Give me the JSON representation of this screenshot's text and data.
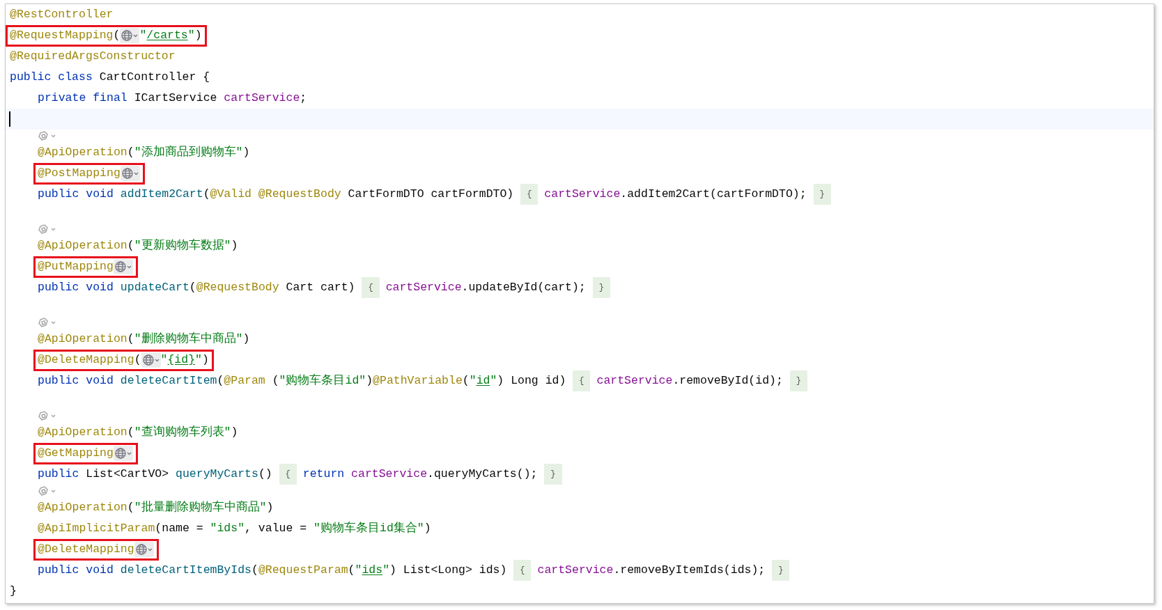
{
  "editor": {
    "lines": [
      {
        "kind": "code",
        "highlighted": false,
        "tokens": [
          {
            "kind": "annotation",
            "text": "@RestController"
          }
        ]
      },
      {
        "kind": "code",
        "highlighted": true,
        "tokens": [
          {
            "kind": "annotation",
            "text": "@RequestMapping"
          },
          {
            "kind": "plain",
            "text": "("
          },
          {
            "kind": "globe"
          },
          {
            "kind": "string",
            "text": "\""
          },
          {
            "kind": "link",
            "text": "/carts"
          },
          {
            "kind": "string",
            "text": "\""
          },
          {
            "kind": "plain",
            "text": ")"
          }
        ]
      },
      {
        "kind": "code",
        "highlighted": false,
        "tokens": [
          {
            "kind": "annotation",
            "text": "@RequiredArgsConstructor"
          }
        ]
      },
      {
        "kind": "code",
        "highlighted": false,
        "tokens": [
          {
            "kind": "keyword",
            "text": "public class "
          },
          {
            "kind": "plain",
            "text": "CartController {"
          }
        ],
        "children": [
          {
            "kind": "code",
            "highlighted": false,
            "tokens": [
              {
                "kind": "keyword",
                "text": "private final "
              },
              {
                "kind": "plain",
                "text": "ICartService "
              },
              {
                "kind": "field",
                "text": "cartService"
              },
              {
                "kind": "plain",
                "text": ";"
              }
            ]
          },
          {
            "kind": "cursor"
          },
          {
            "kind": "hint"
          },
          {
            "kind": "code",
            "highlighted": false,
            "tokens": [
              {
                "kind": "annotation",
                "text": "@ApiOperation"
              },
              {
                "kind": "plain",
                "text": "("
              },
              {
                "kind": "string",
                "text": "\"添加商品到购物车\""
              },
              {
                "kind": "plain",
                "text": ")"
              }
            ]
          },
          {
            "kind": "code",
            "highlighted": true,
            "tokens": [
              {
                "kind": "annotation",
                "text": "@PostMapping"
              },
              {
                "kind": "globe"
              }
            ]
          },
          {
            "kind": "code",
            "highlighted": false,
            "tokens": [
              {
                "kind": "keyword",
                "text": "public void "
              },
              {
                "kind": "method",
                "text": "addItem2Cart"
              },
              {
                "kind": "plain",
                "text": "("
              },
              {
                "kind": "annotation",
                "text": "@Valid @RequestBody "
              },
              {
                "kind": "plain",
                "text": "CartFormDTO cartFormDTO) "
              },
              {
                "kind": "fold",
                "text": "{"
              },
              {
                "kind": "field",
                "text": "cartService"
              },
              {
                "kind": "plain",
                "text": ".addItem2Cart(cartFormDTO); "
              },
              {
                "kind": "fold",
                "text": "}"
              }
            ]
          },
          {
            "kind": "blank"
          },
          {
            "kind": "hint"
          },
          {
            "kind": "code",
            "highlighted": false,
            "tokens": [
              {
                "kind": "annotation",
                "text": "@ApiOperation"
              },
              {
                "kind": "plain",
                "text": "("
              },
              {
                "kind": "string",
                "text": "\"更新购物车数据\""
              },
              {
                "kind": "plain",
                "text": ")"
              }
            ]
          },
          {
            "kind": "code",
            "highlighted": true,
            "tokens": [
              {
                "kind": "annotation",
                "text": "@PutMapping"
              },
              {
                "kind": "globe"
              }
            ]
          },
          {
            "kind": "code",
            "highlighted": false,
            "tokens": [
              {
                "kind": "keyword",
                "text": "public void "
              },
              {
                "kind": "method",
                "text": "updateCart"
              },
              {
                "kind": "plain",
                "text": "("
              },
              {
                "kind": "annotation",
                "text": "@RequestBody "
              },
              {
                "kind": "plain",
                "text": "Cart cart) "
              },
              {
                "kind": "fold",
                "text": "{"
              },
              {
                "kind": "field",
                "text": "cartService"
              },
              {
                "kind": "plain",
                "text": ".updateById(cart); "
              },
              {
                "kind": "fold",
                "text": "}"
              }
            ]
          },
          {
            "kind": "blank"
          },
          {
            "kind": "hint"
          },
          {
            "kind": "code",
            "highlighted": false,
            "tokens": [
              {
                "kind": "annotation",
                "text": "@ApiOperation"
              },
              {
                "kind": "plain",
                "text": "("
              },
              {
                "kind": "string",
                "text": "\"删除购物车中商品\""
              },
              {
                "kind": "plain",
                "text": ")"
              }
            ]
          },
          {
            "kind": "code",
            "highlighted": true,
            "tokens": [
              {
                "kind": "annotation",
                "text": "@DeleteMapping"
              },
              {
                "kind": "plain",
                "text": "("
              },
              {
                "kind": "globe"
              },
              {
                "kind": "string",
                "text": "\""
              },
              {
                "kind": "link",
                "text": "{id}"
              },
              {
                "kind": "string",
                "text": "\""
              },
              {
                "kind": "plain",
                "text": ")"
              }
            ]
          },
          {
            "kind": "code",
            "highlighted": false,
            "tokens": [
              {
                "kind": "keyword",
                "text": "public void "
              },
              {
                "kind": "method",
                "text": "deleteCartItem"
              },
              {
                "kind": "plain",
                "text": "("
              },
              {
                "kind": "annotation",
                "text": "@Param "
              },
              {
                "kind": "plain",
                "text": "("
              },
              {
                "kind": "string",
                "text": "\"购物车条目id\""
              },
              {
                "kind": "plain",
                "text": ")"
              },
              {
                "kind": "annotation",
                "text": "@PathVariable"
              },
              {
                "kind": "plain",
                "text": "("
              },
              {
                "kind": "string",
                "text": "\""
              },
              {
                "kind": "link",
                "text": "id"
              },
              {
                "kind": "string",
                "text": "\""
              },
              {
                "kind": "plain",
                "text": ") Long id) "
              },
              {
                "kind": "fold",
                "text": "{"
              },
              {
                "kind": "field",
                "text": "cartService"
              },
              {
                "kind": "plain",
                "text": ".removeById(id); "
              },
              {
                "kind": "fold",
                "text": "}"
              }
            ]
          },
          {
            "kind": "blank"
          },
          {
            "kind": "hint"
          },
          {
            "kind": "code",
            "highlighted": false,
            "tokens": [
              {
                "kind": "annotation",
                "text": "@ApiOperation"
              },
              {
                "kind": "plain",
                "text": "("
              },
              {
                "kind": "string",
                "text": "\"查询购物车列表\""
              },
              {
                "kind": "plain",
                "text": ")"
              }
            ]
          },
          {
            "kind": "code",
            "highlighted": true,
            "tokens": [
              {
                "kind": "annotation",
                "text": "@GetMapping"
              },
              {
                "kind": "globe"
              }
            ]
          },
          {
            "kind": "code",
            "highlighted": false,
            "tokens": [
              {
                "kind": "keyword",
                "text": "public "
              },
              {
                "kind": "plain",
                "text": "List<CartVO> "
              },
              {
                "kind": "method",
                "text": "queryMyCarts"
              },
              {
                "kind": "plain",
                "text": "() "
              },
              {
                "kind": "fold",
                "text": "{"
              },
              {
                "kind": "keyword",
                "text": "return "
              },
              {
                "kind": "field",
                "text": "cartService"
              },
              {
                "kind": "plain",
                "text": ".queryMyCarts(); "
              },
              {
                "kind": "fold",
                "text": "}"
              }
            ]
          },
          {
            "kind": "hint"
          },
          {
            "kind": "code",
            "highlighted": false,
            "tokens": [
              {
                "kind": "annotation",
                "text": "@ApiOperation"
              },
              {
                "kind": "plain",
                "text": "("
              },
              {
                "kind": "string",
                "text": "\"批量删除购物车中商品\""
              },
              {
                "kind": "plain",
                "text": ")"
              }
            ]
          },
          {
            "kind": "code",
            "highlighted": false,
            "tokens": [
              {
                "kind": "annotation",
                "text": "@ApiImplicitParam"
              },
              {
                "kind": "plain",
                "text": "(name = "
              },
              {
                "kind": "string",
                "text": "\"ids\""
              },
              {
                "kind": "plain",
                "text": ", value = "
              },
              {
                "kind": "string",
                "text": "\"购物车条目id集合\""
              },
              {
                "kind": "plain",
                "text": ")"
              }
            ]
          },
          {
            "kind": "code",
            "highlighted": true,
            "tokens": [
              {
                "kind": "annotation",
                "text": "@DeleteMapping"
              },
              {
                "kind": "globe"
              }
            ]
          },
          {
            "kind": "code",
            "highlighted": false,
            "tokens": [
              {
                "kind": "keyword",
                "text": "public void "
              },
              {
                "kind": "method",
                "text": "deleteCartItemByIds"
              },
              {
                "kind": "plain",
                "text": "("
              },
              {
                "kind": "annotation",
                "text": "@RequestParam"
              },
              {
                "kind": "plain",
                "text": "("
              },
              {
                "kind": "string",
                "text": "\""
              },
              {
                "kind": "link",
                "text": "ids"
              },
              {
                "kind": "string",
                "text": "\""
              },
              {
                "kind": "plain",
                "text": ") List<Long> ids) "
              },
              {
                "kind": "fold",
                "text": "{"
              },
              {
                "kind": "field",
                "text": "cartService"
              },
              {
                "kind": "plain",
                "text": ".removeByItemIds(ids); "
              },
              {
                "kind": "fold",
                "text": "}"
              }
            ]
          }
        ]
      },
      {
        "kind": "code",
        "highlighted": false,
        "tokens": [
          {
            "kind": "plain",
            "text": "}"
          }
        ]
      }
    ]
  }
}
